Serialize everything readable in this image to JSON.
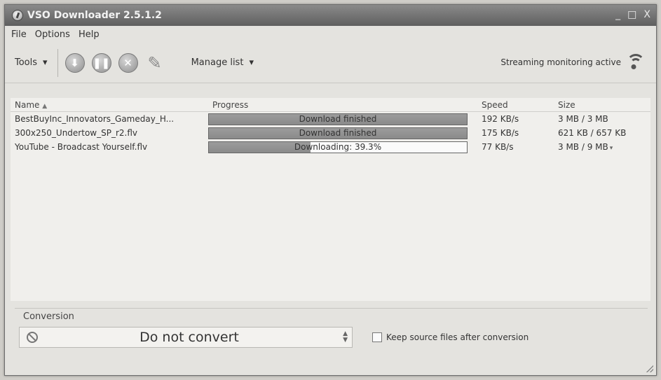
{
  "window": {
    "title": "VSO Downloader 2.5.1.2",
    "controls": [
      "_",
      "□",
      "X"
    ]
  },
  "menu": [
    "File",
    "Options",
    "Help"
  ],
  "toolbar": {
    "tools_label": "Tools",
    "manage_label": "Manage list",
    "status": "Streaming monitoring active",
    "icons": [
      "download-icon",
      "pause-icon",
      "cancel-icon",
      "clean-icon",
      "wifi-icon"
    ]
  },
  "list": {
    "headers": {
      "name": "Name",
      "progress": "Progress",
      "speed": "Speed",
      "size": "Size"
    },
    "rows": [
      {
        "name": "BestBuyInc_Innovators_Gameday_H...",
        "progress_text": "Download finished",
        "progress_value": 1.0,
        "speed": "192 KB/s",
        "size": "3 MB / 3 MB"
      },
      {
        "name": "300x250_Undertow_SP_r2.flv",
        "progress_text": "Download finished",
        "progress_value": 1.0,
        "speed": "175 KB/s",
        "size": "621 KB / 657 KB"
      },
      {
        "name": "YouTube - Broadcast Yourself.flv",
        "progress_text": "Downloading: 39.3%",
        "progress_value": 0.393,
        "speed": "77 KB/s",
        "size": "3 MB / 9 MB"
      }
    ]
  },
  "conversion": {
    "label": "Conversion",
    "value": "Do not convert",
    "keep_label": "Keep source files after conversion",
    "keep_checked": false
  }
}
